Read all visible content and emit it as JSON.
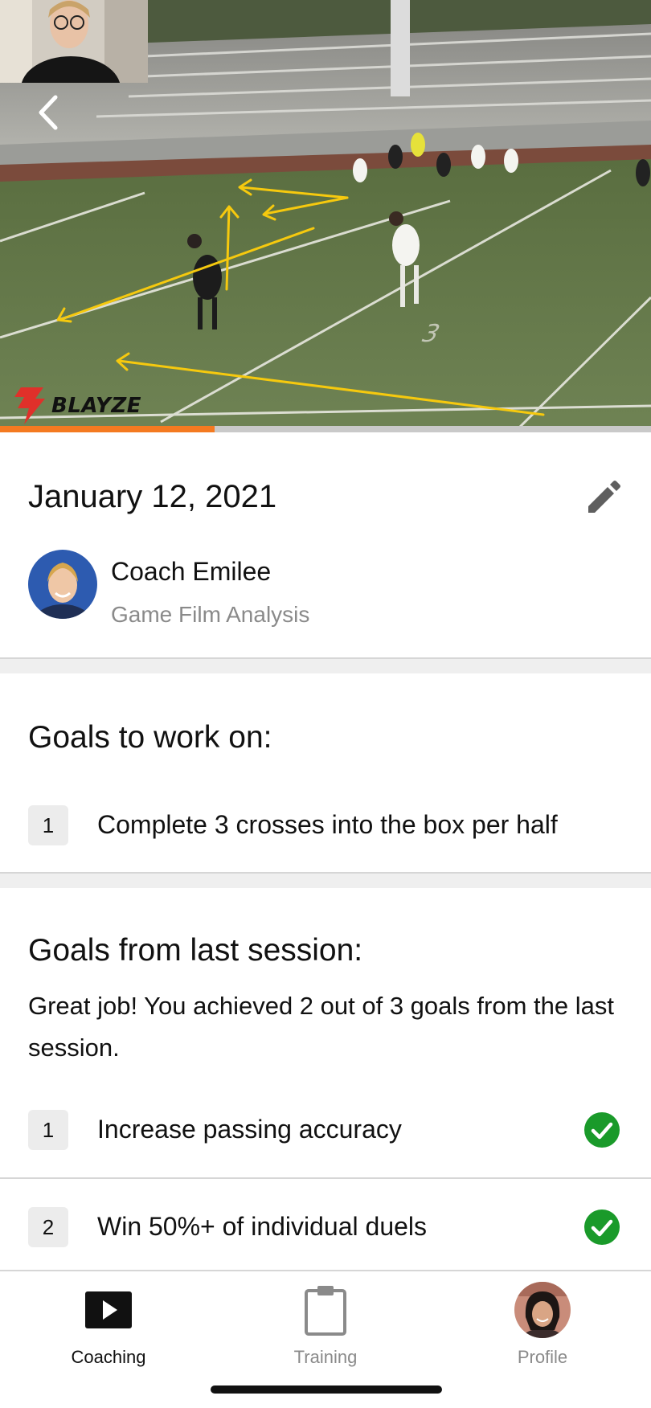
{
  "video": {
    "brand_name": "BLAYZE",
    "progress_fraction": 0.33,
    "accent_color": "#f47a20",
    "annotation_color": "#f6c90e",
    "icons": {
      "back": "chevron-left-icon",
      "brand": "blayze-logo-icon"
    }
  },
  "session": {
    "date": "January 12, 2021",
    "coach_name": "Coach Emilee",
    "session_type": "Game Film Analysis",
    "edit_icon": "pencil-icon"
  },
  "goals_to_work_on": {
    "title": "Goals to work on:",
    "items": [
      {
        "number": "1",
        "text": "Complete 3 crosses into the box per half"
      }
    ]
  },
  "goals_from_last_session": {
    "title": "Goals from last session:",
    "summary": "Great job! You achieved 2 out of 3 goals from the last session.",
    "items": [
      {
        "number": "1",
        "text": "Increase passing accuracy",
        "achieved": true
      },
      {
        "number": "2",
        "text": "Win 50%+ of individual duels",
        "achieved": true
      }
    ],
    "check_color": "#1a9a2a"
  },
  "tabbar": {
    "tabs": [
      {
        "label": "Coaching",
        "icon": "play-icon",
        "active": true
      },
      {
        "label": "Training",
        "icon": "clipboard-icon",
        "active": false
      },
      {
        "label": "Profile",
        "icon": "avatar-icon",
        "active": false
      }
    ]
  }
}
